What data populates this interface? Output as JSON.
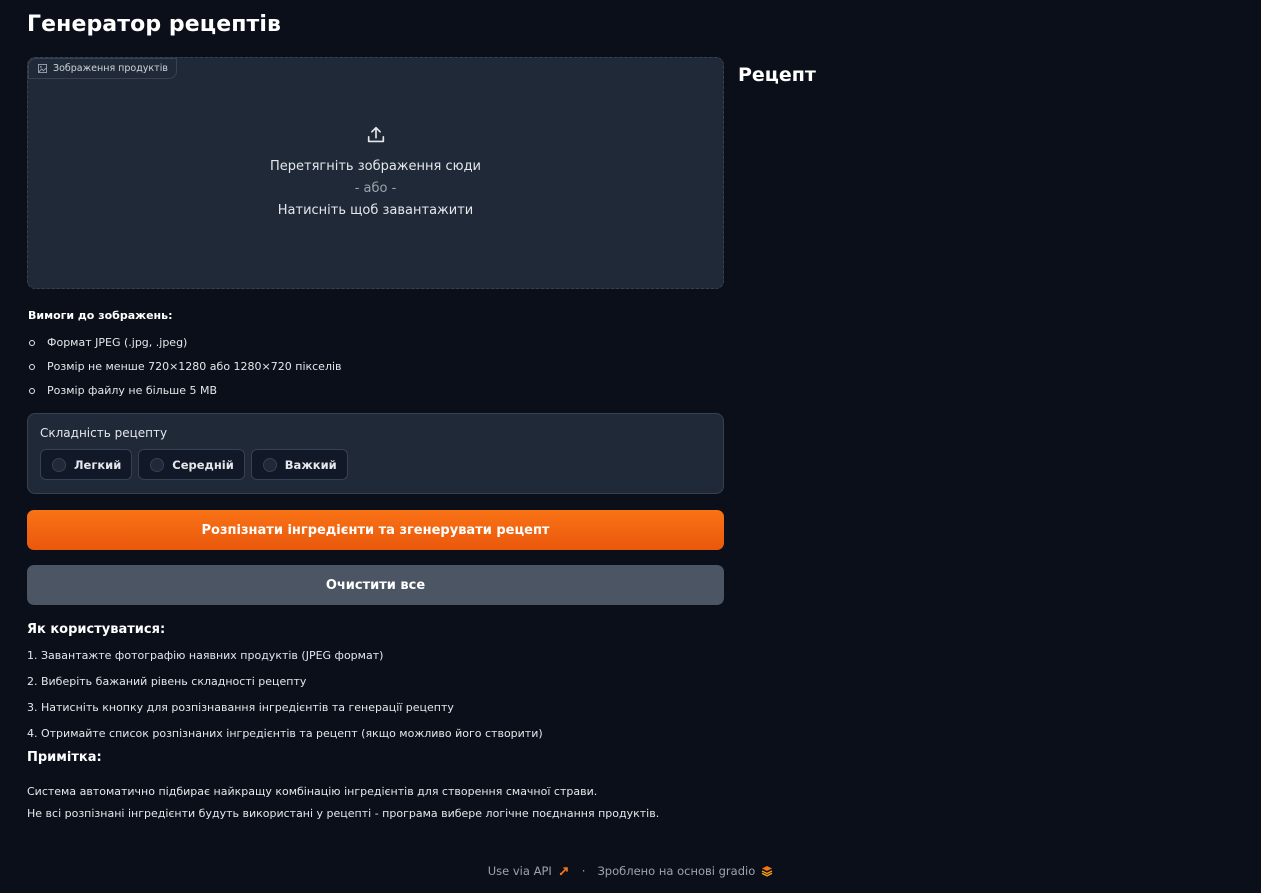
{
  "page": {
    "title": "Генератор рецептів"
  },
  "upload": {
    "label": "Зображення продуктів",
    "line1": "Перетягніть зображення сюди",
    "or": "- або -",
    "line2": "Натисніть щоб завантажити",
    "icon": "upload-icon"
  },
  "requirements": {
    "title": "Вимоги до зображень:",
    "items": [
      "Формат JPEG (.jpg, .jpeg)",
      "Розмір не менше 720×1280 або 1280×720 пікселів",
      "Розмір файлу не більше 5 MB"
    ]
  },
  "difficulty": {
    "label": "Складність рецепту",
    "options": [
      "Легкий",
      "Середній",
      "Важкий"
    ],
    "selected": null
  },
  "buttons": {
    "generate": "Розпізнати інгредієнти та згенерувати рецепт",
    "clear": "Очистити все"
  },
  "howto": {
    "title": "Як користуватися:",
    "steps": [
      "1. Завантажте фотографію наявних продуктів (JPEG формат)",
      "2. Виберіть бажаний рівень складності рецепту",
      "3. Натисніть кнопку для розпізнавання інгредієнтів та генерації рецепту",
      "4. Отримайте список розпізнаних інгредієнтів та рецепт (якщо можливо його створити)"
    ]
  },
  "note": {
    "title": "Примітка:",
    "lines": [
      "Система автоматично підбирає найкращу комбінацію інгредієнтів для створення смачної страви.",
      "Не всі розпізнані інгредієнти будуть використані у рецепті - програма вибере логічне поєднання продуктів."
    ]
  },
  "output": {
    "heading": "Рецепт"
  },
  "footer": {
    "api": "Use via API",
    "separator": "·",
    "built_with": "Зроблено на основі gradio"
  },
  "colors": {
    "background": "#0b0f19",
    "panel": "#1f2937",
    "border": "#374151",
    "accent_orange": "#f97316",
    "secondary_button": "#4b5563"
  }
}
